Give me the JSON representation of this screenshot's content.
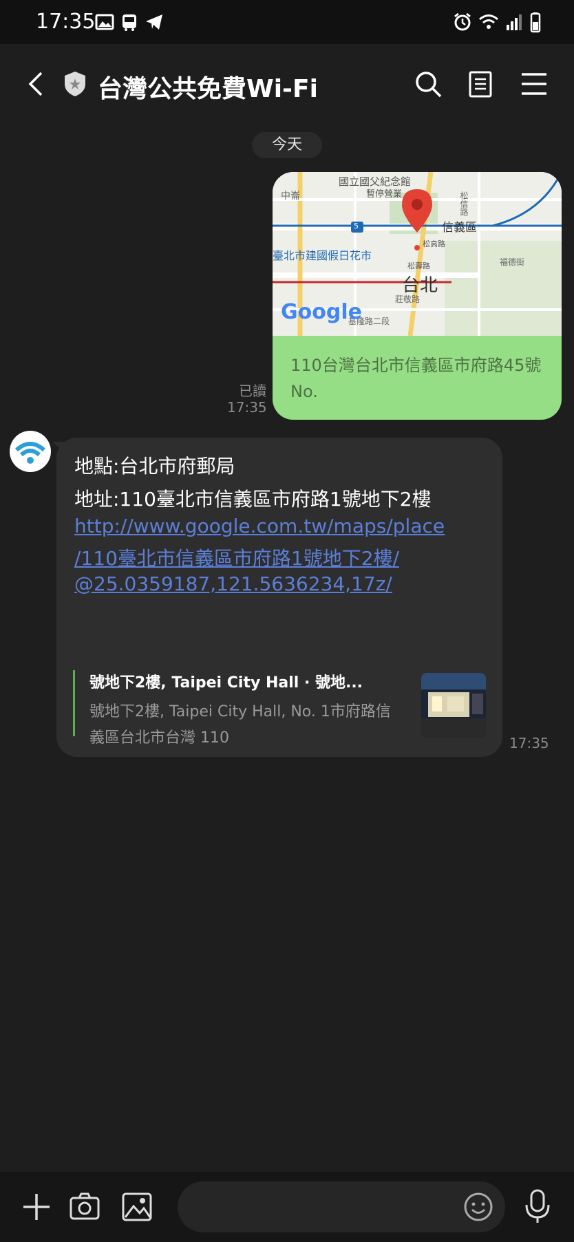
{
  "status_bar": {
    "time": "17:35",
    "icons": [
      "image-icon",
      "bus-icon",
      "telegram-icon",
      "alarm-icon",
      "wifi-icon",
      "signal-icon",
      "battery-icon"
    ]
  },
  "header": {
    "title": "台灣公共免費Wi-Fi",
    "icons": [
      "back-icon",
      "shield-icon",
      "search-icon",
      "notes-icon",
      "menu-icon"
    ]
  },
  "date_separator": "今天",
  "outgoing_message": {
    "map_labels": {
      "top": "國立國父紀念館",
      "top2": "暫停營業",
      "left": "中崙",
      "district": "信義區",
      "street": "松高路",
      "street2": "松壽路",
      "market": "臺北市建國假日花市",
      "city": "台北",
      "route": "5",
      "road1": "松信路",
      "road2": "福德街",
      "road3": "基隆路二段",
      "road4": "莊敬路",
      "brand": "Google"
    },
    "address": "110台灣台北市信義區市府路45號No.",
    "read_label": "已讀",
    "time": "17:35"
  },
  "incoming_message": {
    "line1": "地點:台北市府郵局",
    "line2": "地址:110臺北市信義區市府路1號地下2樓",
    "link_lines": [
      "http://www.google.com.tw/maps/place",
      "/110臺北市信義區市府路1號地下2樓/",
      "@25.0359187,121.5636234,17z/"
    ],
    "preview_title": "號地下2樓, Taipei City Hall · 號地...",
    "preview_desc": "號地下2樓, Taipei City Hall, No. 1市府路信義區台北市台灣 110",
    "time": "17:35"
  },
  "composer": {
    "icons": [
      "plus-icon",
      "camera-icon",
      "gallery-icon",
      "emoji-icon",
      "mic-icon"
    ],
    "placeholder": ""
  },
  "colors": {
    "outgoing_bubble": "#96de85",
    "incoming_bubble": "#2e2e2e",
    "link": "#5b7fd9",
    "background": "#1e1e1e"
  }
}
